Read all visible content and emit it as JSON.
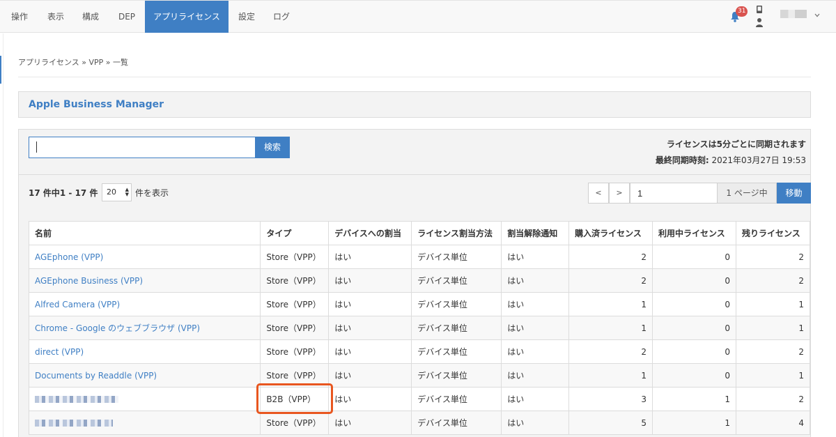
{
  "nav": {
    "items": [
      "操作",
      "表示",
      "構成",
      "DEP",
      "アプリライセンス",
      "設定",
      "ログ"
    ],
    "active_index": 4,
    "notification_count": "31"
  },
  "breadcrumb": "アプリライセンス » VPP » 一覧",
  "section_title": "Apple Business Manager",
  "search": {
    "value": "",
    "button_label": "検索"
  },
  "sync": {
    "line1": "ライセンスは5分ごとに同期されます",
    "line2_label": "最終同期時刻:",
    "line2_value": "2021年03月27日 19:53"
  },
  "pager": {
    "count_text": "17 件中1 - 17 件",
    "per_page": "20",
    "per_page_suffix": "件を表示",
    "prev": "<",
    "next": ">",
    "page_value": "1",
    "page_label": "1 ページ中",
    "go_label": "移動"
  },
  "table": {
    "headers": [
      "名前",
      "タイプ",
      "デバイスへの割当",
      "ライセンス割当方法",
      "割当解除通知",
      "購入済ライセンス",
      "利用中ライセンス",
      "残りライセンス"
    ],
    "rows": [
      {
        "name": "AGEphone (VPP)",
        "type": "Store（VPP）",
        "device": "はい",
        "method": "デバイス単位",
        "notify": "はい",
        "purchased": "2",
        "used": "0",
        "remaining": "2"
      },
      {
        "name": "AGEphone Business (VPP)",
        "type": "Store（VPP）",
        "device": "はい",
        "method": "デバイス単位",
        "notify": "はい",
        "purchased": "2",
        "used": "0",
        "remaining": "2"
      },
      {
        "name": "Alfred Camera (VPP)",
        "type": "Store（VPP）",
        "device": "はい",
        "method": "デバイス単位",
        "notify": "はい",
        "purchased": "1",
        "used": "0",
        "remaining": "1"
      },
      {
        "name": "Chrome - Google のウェブブラウザ (VPP)",
        "type": "Store（VPP）",
        "device": "はい",
        "method": "デバイス単位",
        "notify": "はい",
        "purchased": "1",
        "used": "0",
        "remaining": "1"
      },
      {
        "name": "direct (VPP)",
        "type": "Store（VPP）",
        "device": "はい",
        "method": "デバイス単位",
        "notify": "はい",
        "purchased": "2",
        "used": "0",
        "remaining": "2"
      },
      {
        "name": "Documents by Readdle (VPP)",
        "type": "Store（VPP）",
        "device": "はい",
        "method": "デバイス単位",
        "notify": "はい",
        "purchased": "1",
        "used": "0",
        "remaining": "1"
      },
      {
        "name": "",
        "type": "B2B（VPP）",
        "device": "はい",
        "method": "デバイス単位",
        "notify": "はい",
        "purchased": "3",
        "used": "1",
        "remaining": "2"
      },
      {
        "name": "",
        "type": "Store（VPP）",
        "device": "はい",
        "method": "デバイス単位",
        "notify": "はい",
        "purchased": "5",
        "used": "1",
        "remaining": "4"
      }
    ]
  }
}
